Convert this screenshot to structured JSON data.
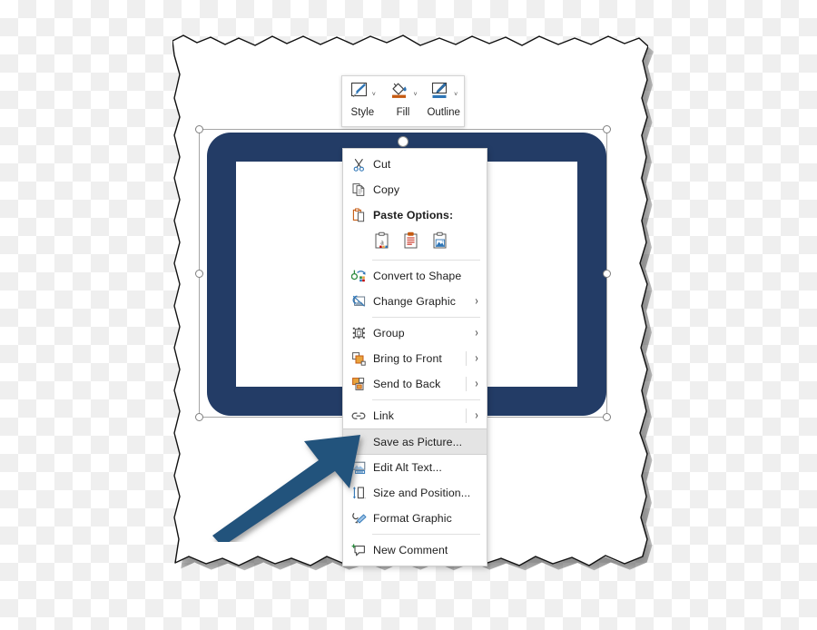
{
  "canvas": {
    "background": "transparency-checkerboard",
    "checker_colors": [
      "#ffffff",
      "#efefef"
    ]
  },
  "paper": {
    "style": "torn-paper-edges",
    "fill": "#ffffff"
  },
  "selected_graphic": {
    "kind": "rounded-rectangle-frame-icon",
    "fill": "#233c66",
    "selected": true,
    "handles": 8,
    "rotation_handle": true
  },
  "mini_toolbar": {
    "buttons": [
      {
        "label": "Style",
        "icon": "shape-style-brush-icon",
        "caret": "˅",
        "accent": ""
      },
      {
        "label": "Fill",
        "icon": "paint-bucket-fill-icon",
        "caret": "˅",
        "accent": "#c55a11"
      },
      {
        "label": "Outline",
        "icon": "pencil-outline-icon",
        "caret": "˅",
        "accent": "#2e75b6"
      }
    ]
  },
  "context_menu": {
    "items": [
      {
        "label": "Cut",
        "icon": "scissors-icon",
        "accel": "t",
        "submenu": false,
        "type": "item"
      },
      {
        "label": "Copy",
        "icon": "copy-pages-icon",
        "accel": "C",
        "submenu": false,
        "type": "item"
      },
      {
        "label": "Paste Options:",
        "icon": "clipboard-icon",
        "accel": "",
        "submenu": false,
        "type": "header"
      },
      {
        "label": "Convert to Shape",
        "icon": "convert-to-shape-icon",
        "accel": "C",
        "submenu": false,
        "type": "item"
      },
      {
        "label": "Change Graphic",
        "icon": "change-graphic-icon",
        "accel": "C",
        "submenu": true,
        "type": "item"
      },
      {
        "label": "Group",
        "icon": "group-objects-icon",
        "accel": "G",
        "submenu": true,
        "type": "item"
      },
      {
        "label": "Bring to Front",
        "icon": "bring-to-front-icon",
        "accel": "r",
        "submenu": true,
        "type": "item"
      },
      {
        "label": "Send to Back",
        "icon": "send-to-back-icon",
        "accel": "k",
        "submenu": true,
        "type": "item"
      },
      {
        "label": "Link",
        "icon": "link-chain-icon",
        "accel": "i",
        "submenu": true,
        "type": "item"
      },
      {
        "label": "Save as Picture...",
        "icon": "",
        "accel": "S",
        "submenu": false,
        "type": "item",
        "highlighted": true
      },
      {
        "label": "Edit Alt Text...",
        "icon": "alt-text-image-icon",
        "accel": "A",
        "submenu": false,
        "type": "item"
      },
      {
        "label": "Size and Position...",
        "icon": "size-position-icon",
        "accel": "z",
        "submenu": false,
        "type": "item"
      },
      {
        "label": "Format Graphic",
        "icon": "format-graphic-icon",
        "accel": "",
        "submenu": false,
        "type": "item"
      },
      {
        "label": "New Comment",
        "icon": "new-comment-icon",
        "accel": "m",
        "submenu": false,
        "type": "item"
      }
    ],
    "paste_options": [
      {
        "name": "keep-text-only-paste-icon"
      },
      {
        "name": "keep-source-formatting-paste-icon"
      },
      {
        "name": "picture-paste-icon"
      }
    ],
    "highlighted_item": "Save as Picture..."
  },
  "annotation": {
    "arrow": {
      "color": "#23527c",
      "points_to": "Save as Picture...",
      "direction": "up-right"
    }
  }
}
